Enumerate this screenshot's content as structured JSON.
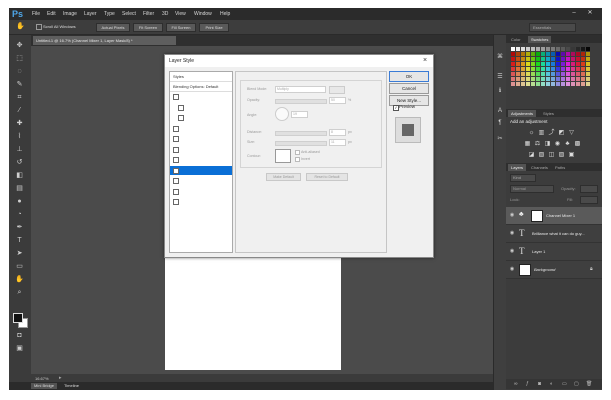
{
  "app": {
    "logo": "Ps",
    "menus": [
      "File",
      "Edit",
      "Image",
      "Layer",
      "Type",
      "Select",
      "Filter",
      "3D",
      "View",
      "Window",
      "Help"
    ],
    "window_controls": [
      "‒",
      "✕"
    ]
  },
  "options_bar": {
    "scroll_all": "Scroll All Windows",
    "buttons": [
      "Actual Pixels",
      "Fit Screen",
      "Fill Screen",
      "Print Size"
    ],
    "workspace": "Essentials"
  },
  "document": {
    "tab_title": "Untitled-1 @ 16.7% (Channel Mixer 1, Layer Mask/8) *",
    "zoom": "16.67%"
  },
  "bottom_tabs": [
    "Mini Bridge",
    "Timeline"
  ],
  "panels": {
    "swatches_tabs": [
      "Color",
      "Swatches"
    ],
    "adjust_tabs": [
      "Adjustments",
      "Styles"
    ],
    "adjust_title": "Add an adjustment",
    "layers_tabs": [
      "Layers",
      "Channels",
      "Paths"
    ],
    "layer_kind": "Kind",
    "blend_mode": "Normal",
    "opacity_label": "Opacity:",
    "lock_label": "Lock:",
    "fill_label": "Fill:",
    "layers": [
      {
        "name": "Channel Mixer 1"
      },
      {
        "name": "Brilliance what it can do guy..."
      },
      {
        "name": "Layer 1"
      },
      {
        "name": "Background"
      }
    ]
  },
  "dialog": {
    "title": "Layer Style",
    "styles_header": "Styles",
    "blending_options": "Blending Options: Default",
    "ok": "OK",
    "cancel": "Cancel",
    "new_style": "New Style...",
    "preview": "Preview",
    "preview_checked": true,
    "blend_mode_label": "Blend Mode:",
    "blend_mode_value": "Multiply",
    "opacity_label": "Opacity:",
    "opacity_value": "50",
    "angle_label": "Angle:",
    "angle_value": "19",
    "distance_label": "Distance:",
    "distance_value": "8",
    "size_label": "Size:",
    "size_value": "11",
    "contour_label": "Contour:",
    "antialiased": "Anti-aliased",
    "invert": "Invert",
    "make_default": "Make Default",
    "reset_default": "Reset to Default",
    "percent": "%",
    "px": "px",
    "style_rows_count": 11,
    "selected_row": 7
  },
  "colors": {
    "accent": "#0a6fd6",
    "ps_blue": "#4ea6e8"
  }
}
